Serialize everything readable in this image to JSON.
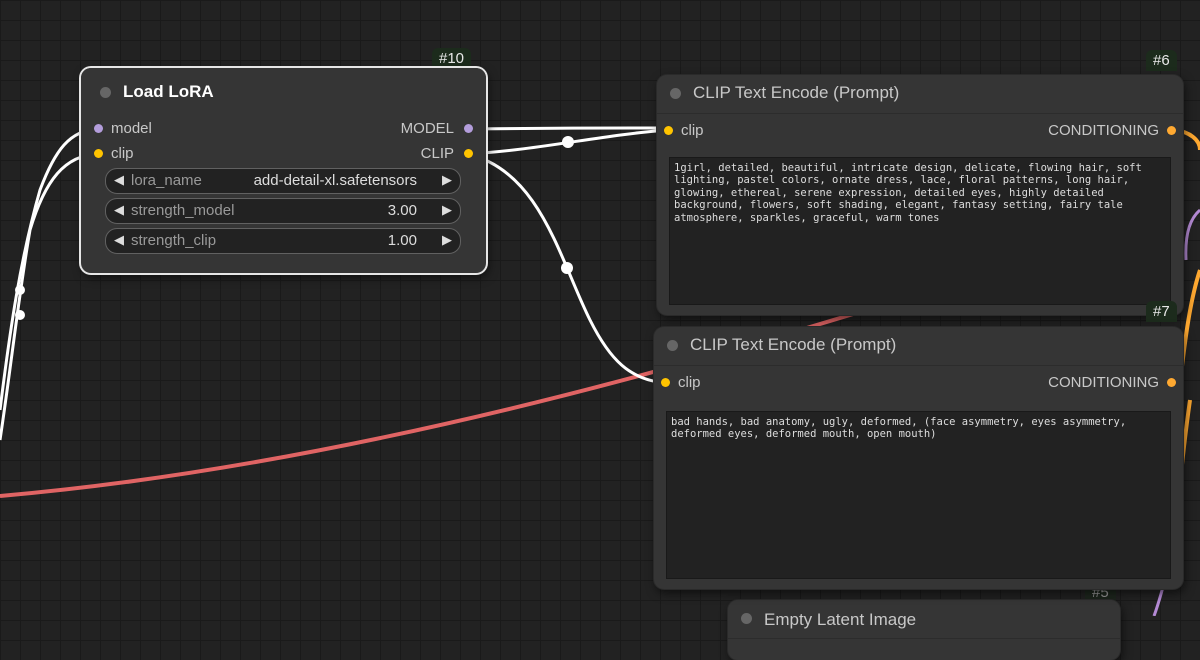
{
  "nodes": {
    "load_lora": {
      "id_badge": "#10",
      "title": "Load LoRA",
      "inputs": [
        "model",
        "clip"
      ],
      "outputs": [
        "MODEL",
        "CLIP"
      ],
      "widgets": [
        {
          "label": "lora_name",
          "value": "add-detail-xl.safetensors"
        },
        {
          "label": "strength_model",
          "value": "3.00"
        },
        {
          "label": "strength_clip",
          "value": "1.00"
        }
      ]
    },
    "clip_positive": {
      "id_badge": "#6",
      "title": "CLIP Text Encode (Prompt)",
      "input": "clip",
      "output": "CONDITIONING",
      "text": "1girl, detailed, beautiful, intricate design, delicate, flowing hair, soft lighting, pastel colors, ornate dress, lace, floral patterns, long hair, glowing, ethereal, serene expression, detailed eyes, highly detailed background, flowers, soft shading, elegant, fantasy setting, fairy tale atmosphere, sparkles, graceful, warm tones"
    },
    "clip_negative": {
      "id_badge": "#7",
      "title": "CLIP Text Encode (Prompt)",
      "input": "clip",
      "output": "CONDITIONING",
      "text": "bad hands, bad anatomy, ugly, deformed, (face asymmetry, eyes asymmetry, deformed eyes, deformed mouth, open mouth)"
    },
    "partial": {
      "id_badge": "#5",
      "title": "Empty Latent Image"
    }
  },
  "colors": {
    "canvas": "#222222",
    "node_bg": "#353535",
    "model_slot": "#b39ddb",
    "clip_slot": "#ffc400",
    "conditioning_slot": "#ffa931",
    "vae_wire": "#e06060",
    "link_white": "#ffffff"
  },
  "icons": {
    "widget_decrement": "triangle-left-icon",
    "widget_increment": "triangle-right-icon"
  }
}
